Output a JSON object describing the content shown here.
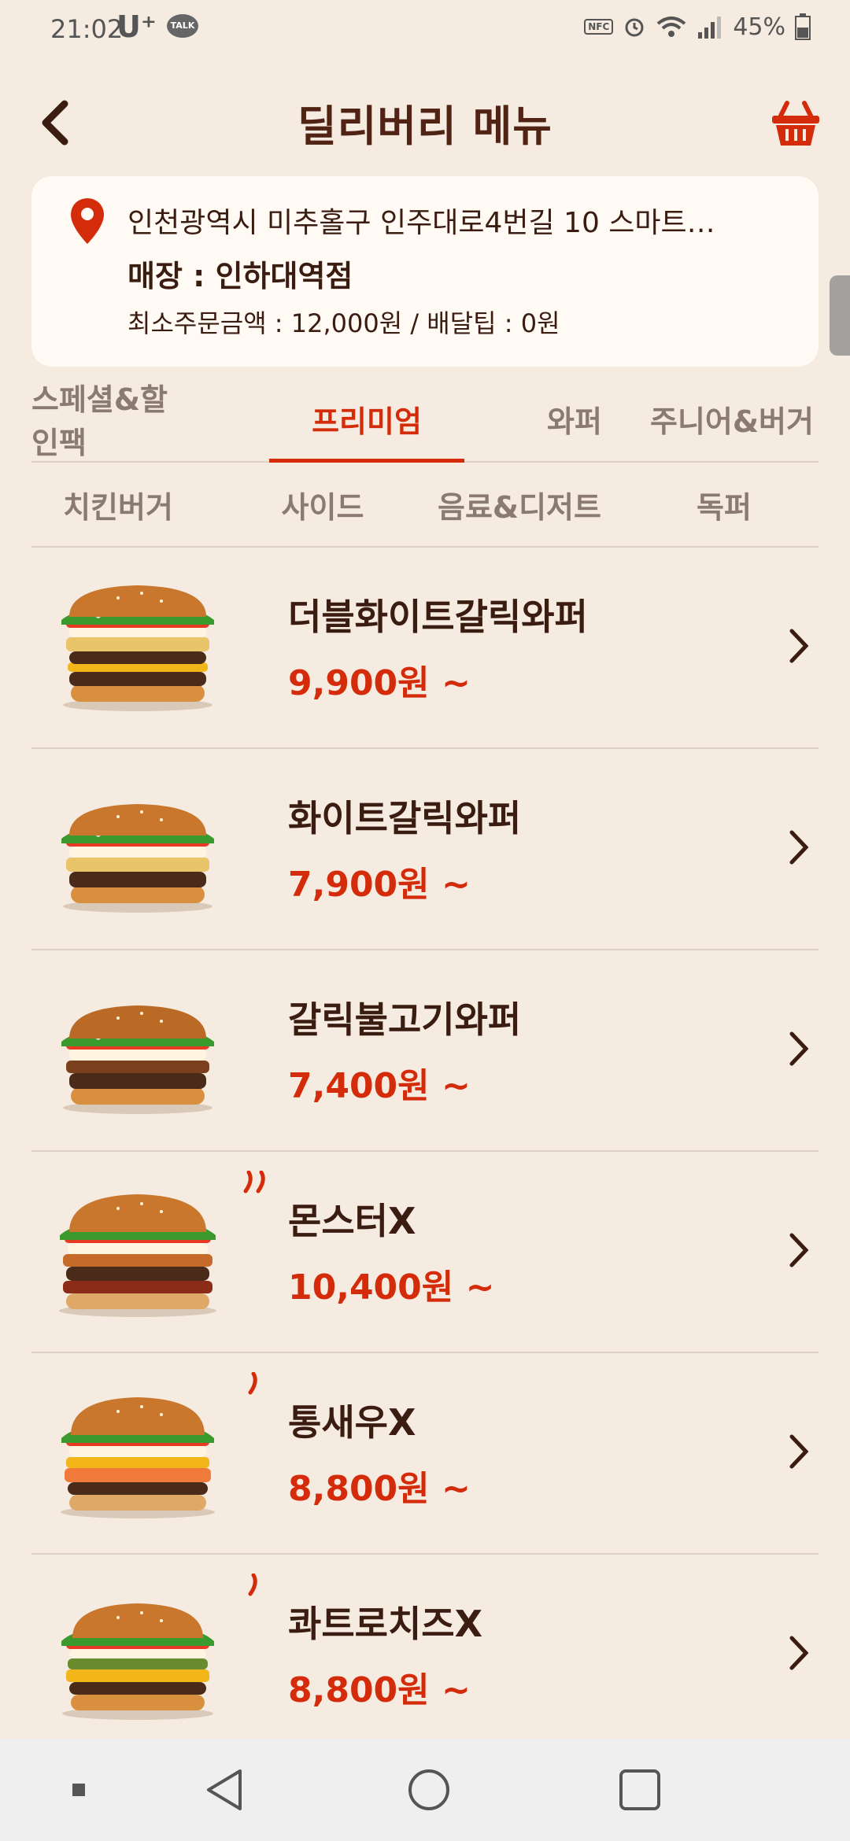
{
  "status_bar": {
    "time": "21:02",
    "carrier": "U⁺",
    "talk_badge": "TALK",
    "nfc": "NFC",
    "battery": "45%"
  },
  "header": {
    "title": "딜리버리 메뉴",
    "back_icon": "chevron-left-icon",
    "cart_icon": "basket-icon"
  },
  "store": {
    "address": "인천광역시 미추홀구 인주대로4번길 10 스마트…",
    "name": "매장 : 인하대역점",
    "order_info": "최소주문금액 : 12,000원 / 배달팁 : 0원"
  },
  "category_tabs_row1": [
    {
      "label": "스페셜&할인팩",
      "active": false
    },
    {
      "label": "프리미엄",
      "active": true
    },
    {
      "label": "와퍼",
      "active": false
    },
    {
      "label": "주니어&버거",
      "active": false
    }
  ],
  "category_tabs_row2": [
    {
      "label": "치킨버거"
    },
    {
      "label": "사이드"
    },
    {
      "label": "음료&디저트"
    },
    {
      "label": "독퍼"
    }
  ],
  "menu_items": [
    {
      "name": "더블화이트갈릭와퍼",
      "price": "9,900원 ~",
      "spicy_level": 0
    },
    {
      "name": "화이트갈릭와퍼",
      "price": "7,900원 ~",
      "spicy_level": 0
    },
    {
      "name": "갈릭불고기와퍼",
      "price": "7,400원 ~",
      "spicy_level": 0
    },
    {
      "name": "몬스터X",
      "price": "10,400원 ~",
      "spicy_level": 2
    },
    {
      "name": "통새우X",
      "price": "8,800원 ~",
      "spicy_level": 1
    },
    {
      "name": "콰트로치즈X",
      "price": "8,800원 ~",
      "spicy_level": 1
    }
  ],
  "colors": {
    "background": "#f5ebe0",
    "accent": "#d42c0a",
    "text": "#502314",
    "card": "#fffaf4"
  }
}
